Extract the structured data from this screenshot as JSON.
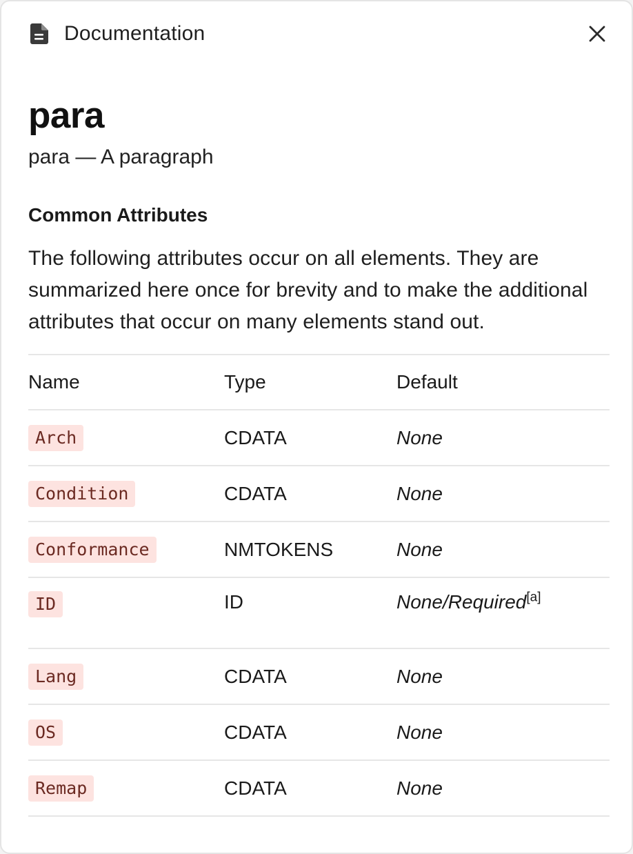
{
  "header": {
    "title": "Documentation",
    "icon": "document-icon",
    "close_icon": "close-icon"
  },
  "doc": {
    "title": "para",
    "subtitle": "para — A paragraph",
    "section_heading": "Common Attributes",
    "section_description": "The following attributes occur on all elements. They are summarized here once for brevity and to make the additional attributes that occur on many elements stand out."
  },
  "table": {
    "headers": [
      "Name",
      "Type",
      "Default"
    ],
    "rows": [
      {
        "name": "Arch",
        "type": "CDATA",
        "default": "None",
        "footnote": ""
      },
      {
        "name": "Condition",
        "type": "CDATA",
        "default": "None",
        "footnote": ""
      },
      {
        "name": "Conformance",
        "type": "NMTOKENS",
        "default": "None",
        "footnote": ""
      },
      {
        "name": "ID",
        "type": "ID",
        "default": "None/Required",
        "footnote": "[a]"
      },
      {
        "name": "Lang",
        "type": "CDATA",
        "default": "None",
        "footnote": ""
      },
      {
        "name": "OS",
        "type": "CDATA",
        "default": "None",
        "footnote": ""
      },
      {
        "name": "Remap",
        "type": "CDATA",
        "default": "None",
        "footnote": ""
      }
    ]
  },
  "colors": {
    "code_text": "#6b2a22",
    "code_background": "#fde3e0",
    "border": "#e6e6e6"
  }
}
